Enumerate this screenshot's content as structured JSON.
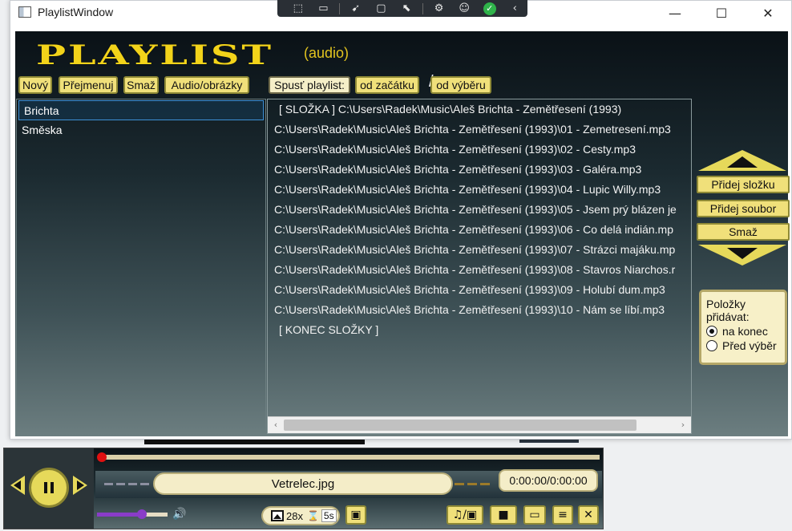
{
  "window": {
    "title": "PlaylistWindow",
    "controls": {
      "minimize": "—",
      "maximize": "☐",
      "close": "✕"
    }
  },
  "capture_toolbar": {
    "icons": [
      "region-capture-icon",
      "video-icon",
      "pointer-icon",
      "window-icon",
      "cursor-select-icon",
      "settings-icon",
      "accessibility-icon",
      "check-icon",
      "collapse-icon"
    ]
  },
  "header": {
    "logo": "PLAYLIST",
    "mode": "(audio)"
  },
  "toolbar": {
    "new": "Nový",
    "rename": "Přejmenuj",
    "delete": "Smaž",
    "audio_images": "Audio/obrázky",
    "run_playlist": "Spusť playlist:",
    "from_start": "od začátku",
    "separator": "/",
    "from_selection": "od výběru"
  },
  "playlists": [
    {
      "label": "Brichta",
      "selected": true
    },
    {
      "label": "Směska",
      "selected": false
    }
  ],
  "tracks": [
    "[ SLOŽKA ] C:\\Users\\Radek\\Music\\Aleš Brichta - Zemětřesení (1993)",
    "C:\\Users\\Radek\\Music\\Aleš Brichta - Zemětřesení (1993)\\01 - Zemetresení.mp3",
    "C:\\Users\\Radek\\Music\\Aleš Brichta - Zemětřesení (1993)\\02 - Cesty.mp3",
    "C:\\Users\\Radek\\Music\\Aleš Brichta - Zemětřesení (1993)\\03 - Galéra.mp3",
    "C:\\Users\\Radek\\Music\\Aleš Brichta - Zemětřesení (1993)\\04 - Lupic Willy.mp3",
    "C:\\Users\\Radek\\Music\\Aleš Brichta - Zemětřesení (1993)\\05 - Jsem prý blázen je",
    "C:\\Users\\Radek\\Music\\Aleš Brichta - Zemětřesení (1993)\\06 - Co delá indián.mp",
    "C:\\Users\\Radek\\Music\\Aleš Brichta - Zemětřesení (1993)\\07 - Strázci majáku.mp",
    "C:\\Users\\Radek\\Music\\Aleš Brichta - Zemětřesení (1993)\\08 - Stavros Niarchos.r",
    "C:\\Users\\Radek\\Music\\Aleš Brichta - Zemětřesení (1993)\\09 - Holubí dum.mp3",
    "C:\\Users\\Radek\\Music\\Aleš Brichta - Zemětřesení (1993)\\10 - Nám se líbí.mp3",
    "[ KONEC SLOŽKY ]"
  ],
  "scrollbar": {
    "left": "‹",
    "right": "›"
  },
  "side": {
    "add_folder": "Přidej složku",
    "add_file": "Přidej soubor",
    "delete": "Smaž"
  },
  "add_mode": {
    "title": "Položky přidávat:",
    "options": [
      {
        "label": "na konec",
        "checked": true
      },
      {
        "label": "Před výběr",
        "checked": false
      }
    ]
  },
  "player": {
    "track": "Vetrelec.jpg",
    "time": "0:00:00/0:00:00",
    "volume": 0.64,
    "speaker": "🔊",
    "image_count": "28x",
    "hourglass": "⌛",
    "interval": "5s",
    "buttons": {
      "audio_images": "♫/▣",
      "camera": "■",
      "folder": "▭",
      "list": "≡",
      "collapse": "✕"
    }
  },
  "colors": {
    "accent_yellow": "#f2d31a",
    "button_yellow": "#f0e07a",
    "cream": "#f4edc8",
    "seek_red": "#e01010",
    "volume_purple": "#8a3cc8"
  }
}
